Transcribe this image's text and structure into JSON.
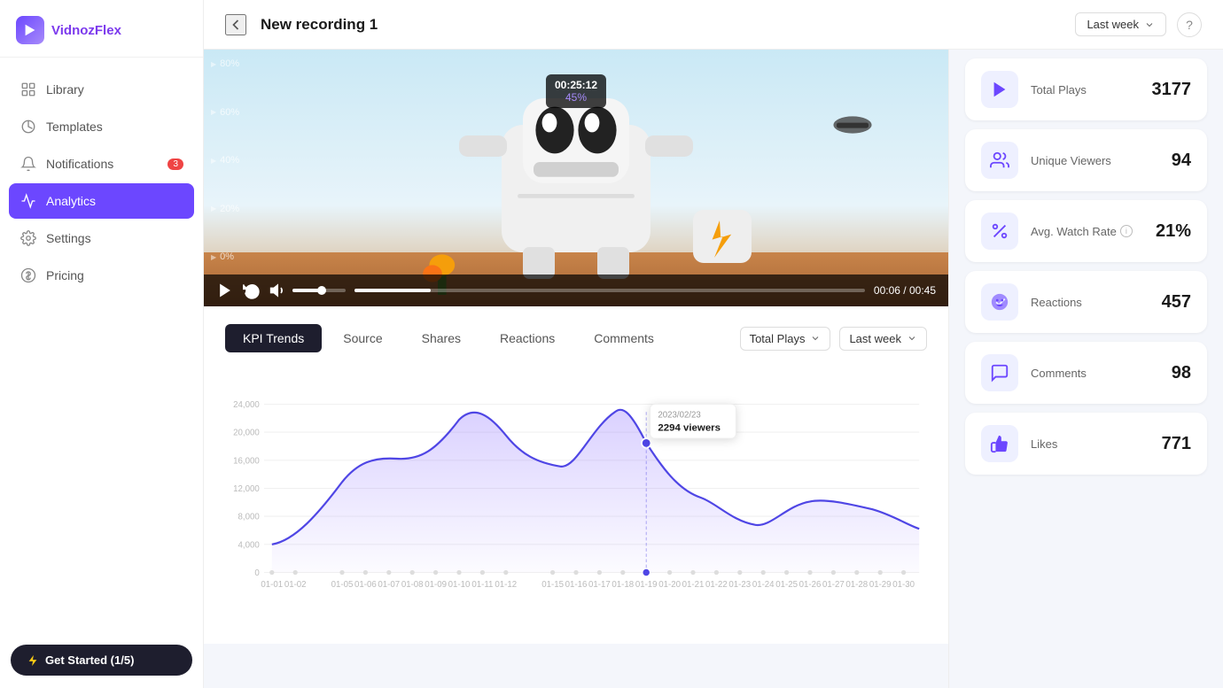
{
  "app": {
    "name": "Vidnoz",
    "name_highlight": "Flex"
  },
  "topbar": {
    "title": "New recording 1",
    "back_label": "back",
    "period_dropdown": "Last week",
    "help_label": "?"
  },
  "sidebar": {
    "items": [
      {
        "id": "library",
        "label": "Library",
        "icon": "library-icon",
        "active": false,
        "badge": null
      },
      {
        "id": "templates",
        "label": "Templates",
        "icon": "templates-icon",
        "active": false,
        "badge": null
      },
      {
        "id": "notifications",
        "label": "Notifications",
        "icon": "bell-icon",
        "active": false,
        "badge": "3"
      },
      {
        "id": "analytics",
        "label": "Analytics",
        "icon": "analytics-icon",
        "active": true,
        "badge": null
      },
      {
        "id": "settings",
        "label": "Settings",
        "icon": "settings-icon",
        "active": false,
        "badge": null
      },
      {
        "id": "pricing",
        "label": "Pricing",
        "icon": "pricing-icon",
        "active": false,
        "badge": null
      }
    ],
    "get_started": "Get Started (1/5)"
  },
  "stats": [
    {
      "id": "total-plays",
      "label": "Total Plays",
      "value": "3177",
      "icon": "play-icon"
    },
    {
      "id": "unique-viewers",
      "label": "Unique Viewers",
      "value": "94",
      "icon": "users-icon"
    },
    {
      "id": "avg-watch-rate",
      "label": "Avg. Watch Rate",
      "value": "21%",
      "icon": "percent-icon",
      "info": true
    },
    {
      "id": "reactions",
      "label": "Reactions",
      "value": "457",
      "icon": "reaction-icon"
    },
    {
      "id": "comments",
      "label": "Comments",
      "value": "98",
      "icon": "comment-icon"
    },
    {
      "id": "likes",
      "label": "Likes",
      "value": "771",
      "icon": "like-icon"
    }
  ],
  "video": {
    "tooltip_time": "00:25:12",
    "tooltip_pct": "45%",
    "time_current": "00:06",
    "time_total": "00:45",
    "y_labels": [
      "80%",
      "60%",
      "40%",
      "20%",
      "0%"
    ]
  },
  "chart": {
    "tabs": [
      {
        "id": "kpi-trends",
        "label": "KPI Trends",
        "active": true
      },
      {
        "id": "source",
        "label": "Source",
        "active": false
      },
      {
        "id": "shares",
        "label": "Shares",
        "active": false
      },
      {
        "id": "reactions",
        "label": "Reactions",
        "active": false
      },
      {
        "id": "comments",
        "label": "Comments",
        "active": false
      }
    ],
    "metric_dropdown": "Total Plays",
    "period_dropdown": "Last week",
    "tooltip": {
      "date": "2023/02/23",
      "value": "2294 viewers"
    },
    "y_labels": [
      "24,000",
      "20,000",
      "16,000",
      "12,000",
      "8,000",
      "4,000",
      "0"
    ],
    "x_labels": [
      "01-01",
      "01-02",
      "01-05",
      "01-06",
      "01-07",
      "01-08",
      "01-09",
      "01-10",
      "01-11",
      "01-12",
      "01-15",
      "01-16",
      "01-17",
      "01-18",
      "01-19",
      "01-20",
      "01-21",
      "01-22",
      "01-23",
      "01-24",
      "01-25",
      "01-26",
      "01-27",
      "01-28",
      "01-29",
      "01-30"
    ]
  }
}
